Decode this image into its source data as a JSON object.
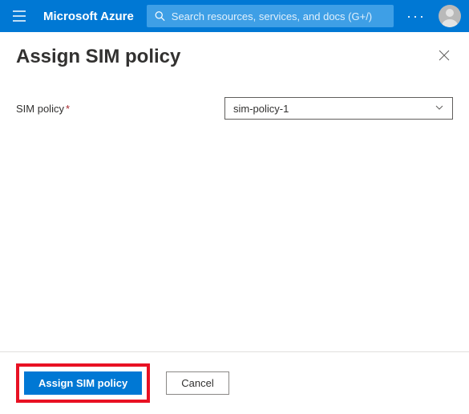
{
  "header": {
    "brand": "Microsoft Azure",
    "search_placeholder": "Search resources, services, and docs (G+/)"
  },
  "blade": {
    "title": "Assign SIM policy"
  },
  "form": {
    "sim_policy_label": "SIM policy",
    "sim_policy_value": "sim-policy-1"
  },
  "footer": {
    "assign_label": "Assign SIM policy",
    "cancel_label": "Cancel"
  }
}
